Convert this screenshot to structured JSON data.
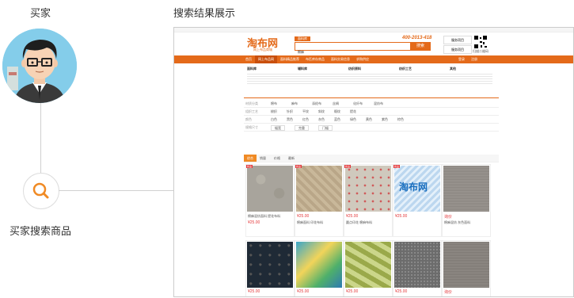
{
  "left_panel": {
    "buyer_label": "买家",
    "search_step_label": "买家搜索商品",
    "icons": {
      "avatar": "buyer-avatar",
      "search": "search-icon"
    },
    "colors": {
      "connector": "#d0d0d0",
      "accent": "#f08a24"
    }
  },
  "result_title": "搜索结果展示",
  "site": {
    "logo": "淘布网",
    "logo_sub": "网上布品商城",
    "hotline": "400-2013-418",
    "search_scope": "面料库",
    "search_value": "棉麻",
    "search_button": "搜索",
    "right_links": [
      "服务项目",
      "服务项目"
    ],
    "qr_caption": "扫描二维码",
    "nav": [
      "首页",
      "网上布品网",
      "面料精品推荐",
      "布匹库存商品",
      "面料交易信息",
      "求购供应"
    ],
    "nav_right": [
      "登录",
      "注册"
    ],
    "category_heads": [
      "面料库",
      "辅料库",
      "纺织原料",
      "纺织工艺",
      "其他"
    ]
  },
  "filters": {
    "rows": [
      {
        "label": "材质分类",
        "values": [
          "棉布",
          "麻布",
          "涤纶布",
          "丝绸",
          "化纤布",
          "混纺布"
        ]
      },
      {
        "label": "组织工艺",
        "values": [
          "梭织",
          "针织",
          "平纹",
          "斜纹",
          "缎纹",
          "提花"
        ]
      },
      {
        "label": "颜色",
        "values": [
          "白色",
          "黑色",
          "红色",
          "灰色",
          "蓝色",
          "绿色",
          "黄色",
          "紫色",
          "棕色"
        ]
      },
      {
        "label": "规格尺寸",
        "values": [
          "幅宽",
          "克重",
          "门幅"
        ]
      }
    ],
    "tabs": [
      "综合",
      "销量",
      "价格",
      "最新"
    ]
  },
  "colors": {
    "nav_orange": "#e46a1a",
    "tab_orange": "#f08a24",
    "price_red": "#e4393c"
  },
  "products_row1": [
    {
      "price": "¥25.00",
      "name": "棉麻混纺面料 提花布料",
      "badge": "新品"
    },
    {
      "price": "¥25.00",
      "name": "棉麻面料 印花布料",
      "badge": "新品"
    },
    {
      "price": "¥25.00",
      "name": "圆点印花 棉麻布料",
      "badge": "新品"
    },
    {
      "price": "¥25.00",
      "name": "淘布网",
      "badge": "新品"
    },
    {
      "price": "询价",
      "name": "棉麻混纺 灰色面料",
      "badge": ""
    }
  ],
  "products_row2": [
    {
      "price": "¥25.00"
    },
    {
      "price": "¥25.00"
    },
    {
      "price": "¥25.00"
    },
    {
      "price": "¥25.00"
    },
    {
      "price": "询价"
    }
  ]
}
